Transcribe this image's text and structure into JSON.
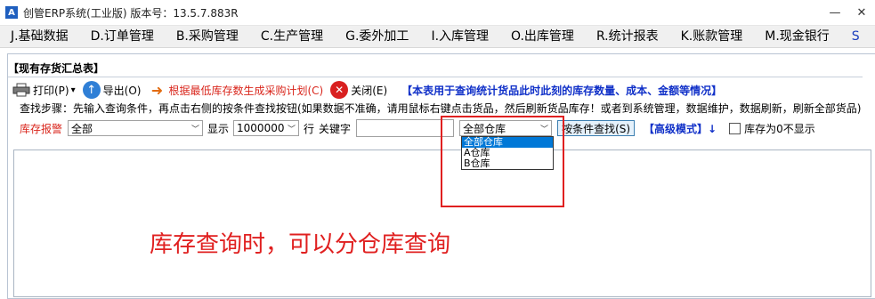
{
  "window": {
    "title": "创管ERP系统(工业版) 版本号：13.5.7.883R",
    "app_icon_glyph": "A",
    "controls": {
      "minimize": "—",
      "close": "✕"
    }
  },
  "menubar": {
    "items": [
      {
        "label": "J.基础数据"
      },
      {
        "label": "D.订单管理"
      },
      {
        "label": "B.采购管理"
      },
      {
        "label": "C.生产管理"
      },
      {
        "label": "G.委外加工"
      },
      {
        "label": "I.入库管理"
      },
      {
        "label": "O.出库管理"
      },
      {
        "label": "R.统计报表"
      },
      {
        "label": "K.账款管理"
      },
      {
        "label": "M.现金银行"
      },
      {
        "label": "S"
      }
    ]
  },
  "panel": {
    "title": "【现有存货汇总表】"
  },
  "toolbar": {
    "print_label": "打印(P)",
    "print_arrow": "▾",
    "export_label": "导出(O)",
    "plan_label": "根据最低库存数生成采购计划(C)",
    "close_label": "关闭(E)",
    "info_text": "【本表用于查询统计货品此时此刻的库存数量、成本、金额等情况】"
  },
  "steps_text": "查找步骤：先输入查询条件，再点击右侧的按条件查找按钮(如果数据不准确，请用鼠标右键点击货品，然后刷新货品库存！或者到系统管理，数据维护，数据刷新，刷新全部货品)",
  "filters": {
    "alert_label": "库存报警",
    "alert_value": "全部",
    "display_label": "显示",
    "display_value": "1000000",
    "row_label": "行",
    "keyword_label": "关键字",
    "keyword_value": "",
    "warehouse_value": "全部仓库",
    "search_button": "按条件查找(S)",
    "advanced_label": "【高级模式】↓",
    "hide_zero_label": "库存为0不显示",
    "hide_zero_checked": false
  },
  "warehouse_dropdown": {
    "options": [
      {
        "label": "全部仓库",
        "selected": true
      },
      {
        "label": "A仓库",
        "selected": false
      },
      {
        "label": "B仓库",
        "selected": false
      }
    ]
  },
  "annotation": {
    "text": "库存查询时，可以分仓库查询",
    "color": "#e02020"
  },
  "colors": {
    "accent_blue": "#1030c8",
    "warning_red": "#d9261c",
    "selection_blue": "#0078d7"
  }
}
